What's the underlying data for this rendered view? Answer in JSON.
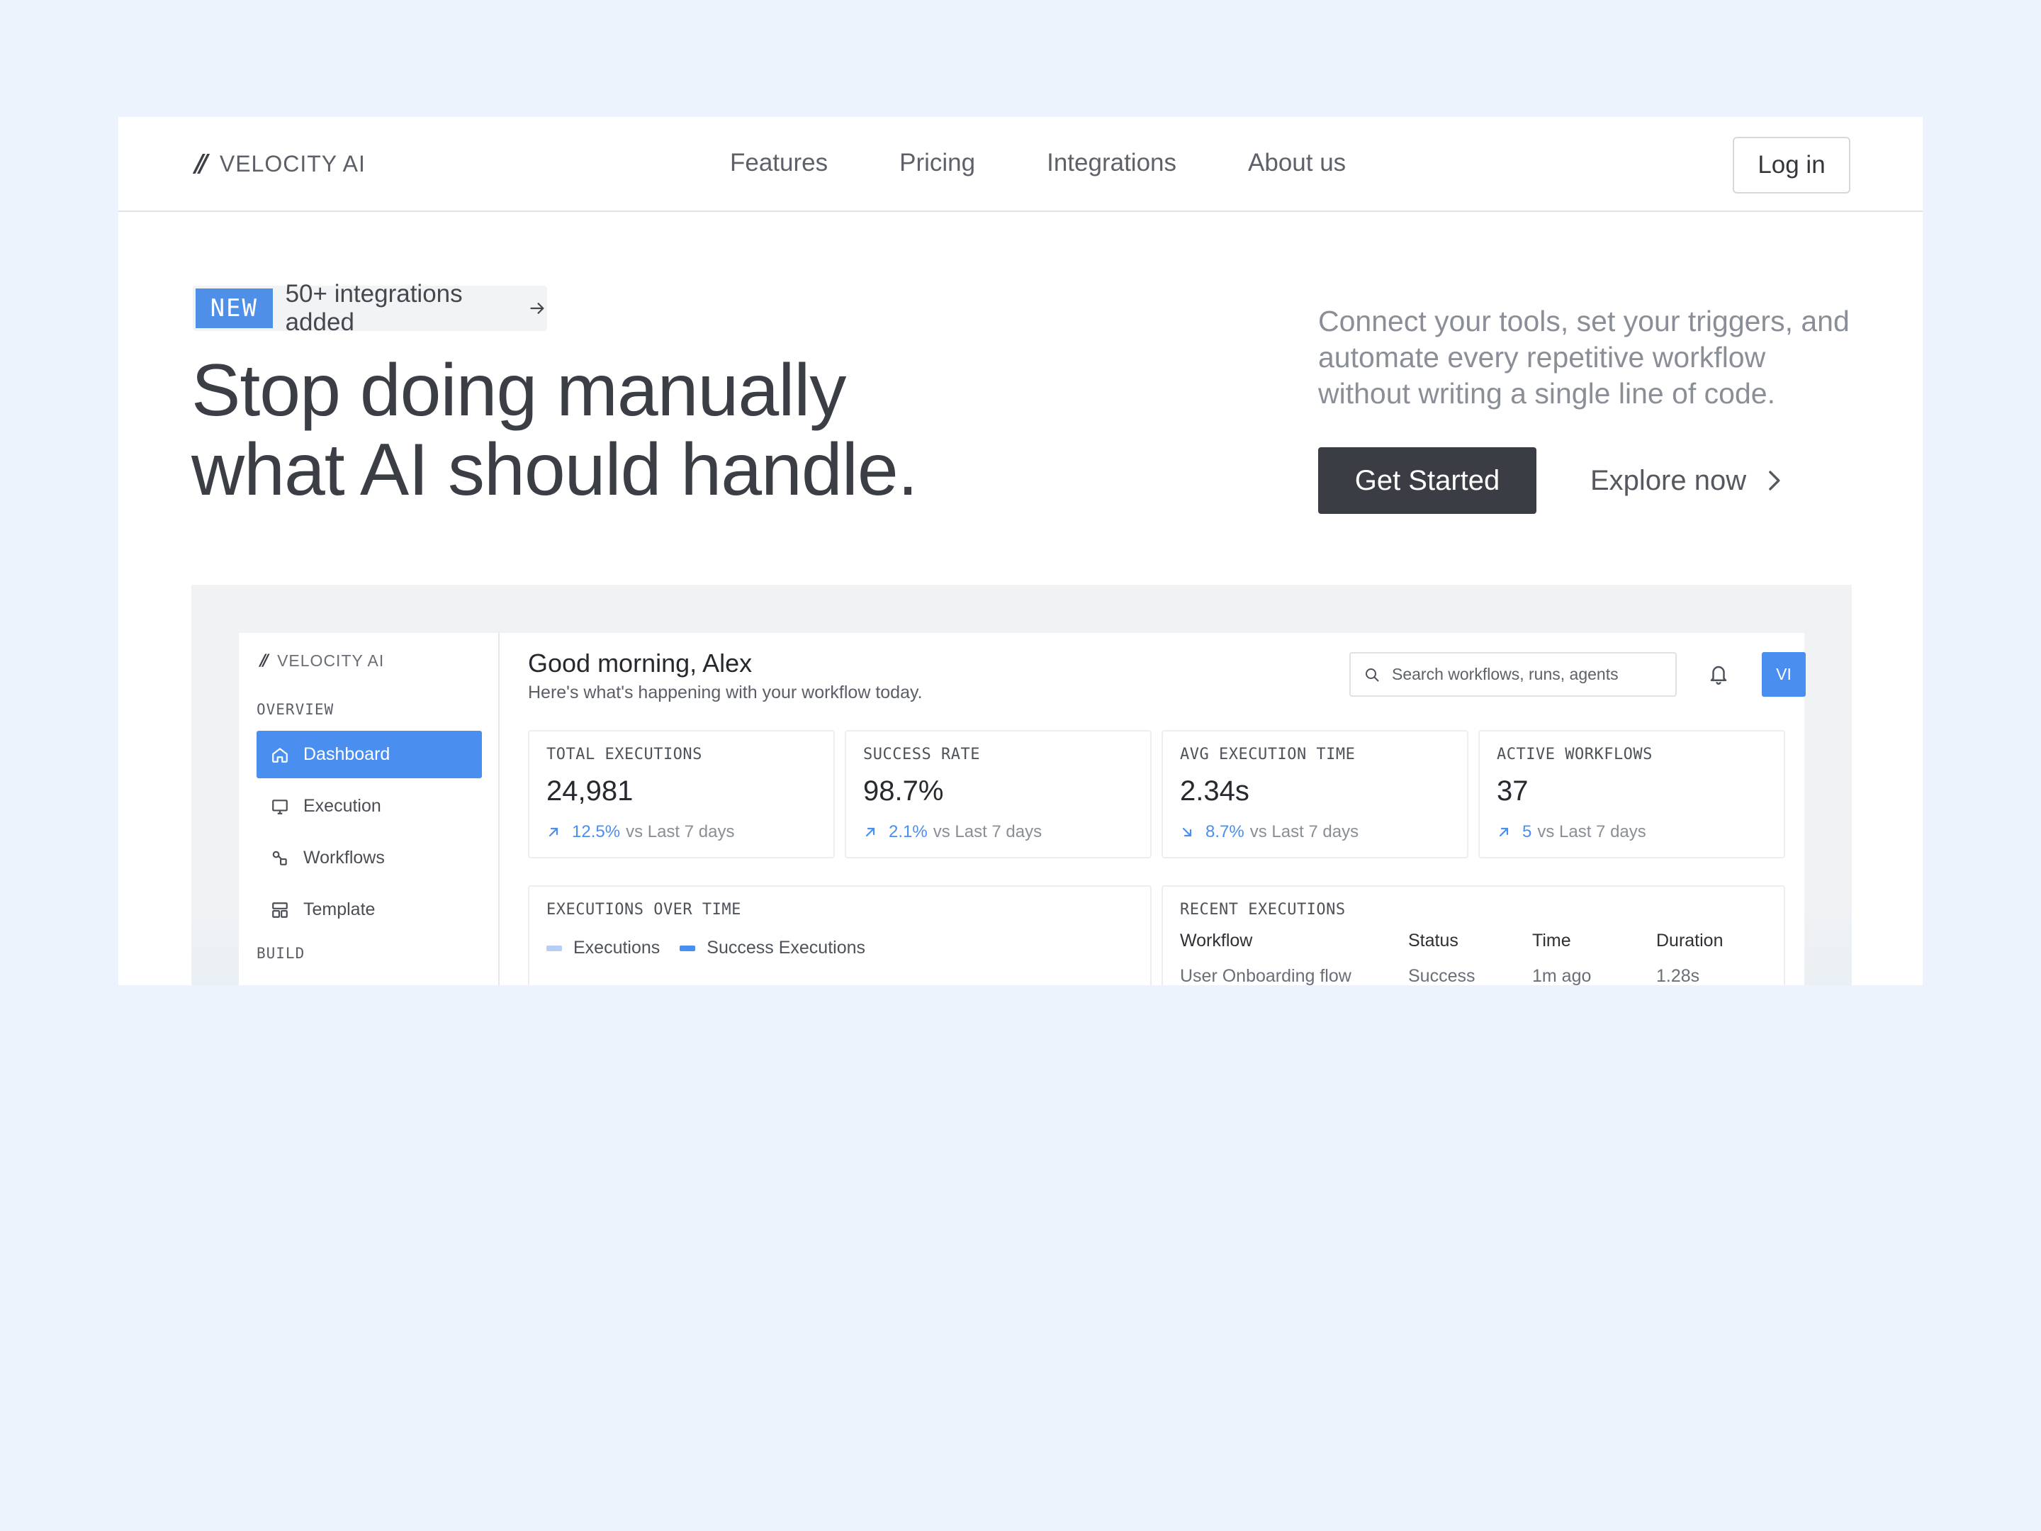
{
  "nav": {
    "brand_mark": "//",
    "brand_name": "VELOCITY AI",
    "links": [
      "Features",
      "Pricing",
      "Integrations",
      "About us"
    ],
    "login_label": "Log in"
  },
  "hero": {
    "badge_tag": "NEW",
    "badge_text": "50+ integrations added",
    "title_line1": "Stop doing manually",
    "title_line2": "what AI should handle.",
    "description": "Connect your tools, set your triggers, and automate every repetitive workflow without writing a single line of code.",
    "cta_primary": "Get Started",
    "cta_secondary": "Explore now"
  },
  "app": {
    "brand_mark": "//",
    "brand_name": "VELOCITY AI",
    "sidebar": {
      "section_overview": "OVERVIEW",
      "section_build": "BUILD",
      "items": [
        {
          "label": "Dashboard",
          "icon": "home-icon",
          "active": true
        },
        {
          "label": "Execution",
          "icon": "monitor-icon",
          "active": false
        },
        {
          "label": "Workflows",
          "icon": "workflow-icon",
          "active": false
        },
        {
          "label": "Template",
          "icon": "template-icon",
          "active": false
        }
      ]
    },
    "greeting": "Good morning, Alex",
    "greeting_sub": "Here's what's happening with your workflow today.",
    "search_placeholder": "Search workflows, runs, agents",
    "avatar_initials": "VI",
    "stats": [
      {
        "label": "TOTAL EXECUTIONS",
        "value": "24,981",
        "pct": "12.5%",
        "trend": "up",
        "suffix": "vs Last 7 days"
      },
      {
        "label": "SUCCESS RATE",
        "value": "98.7%",
        "pct": "2.1%",
        "trend": "up",
        "suffix": "vs Last 7 days"
      },
      {
        "label": "AVG EXECUTION TIME",
        "value": "2.34s",
        "pct": "8.7%",
        "trend": "down",
        "suffix": "vs Last 7 days"
      },
      {
        "label": "ACTIVE WORKFLOWS",
        "value": "37",
        "pct": "5",
        "trend": "up",
        "suffix": "vs Last 7 days"
      }
    ],
    "executions_chart": {
      "title": "EXECUTIONS OVER TIME",
      "legend": [
        {
          "label": "Executions",
          "color": "#b7cdf3"
        },
        {
          "label": "Success Executions",
          "color": "#4a8ef0"
        }
      ]
    },
    "recent": {
      "title": "RECENT EXECUTIONS",
      "columns": [
        "Workflow",
        "Status",
        "Time",
        "Duration"
      ],
      "rows": [
        [
          "User Onboarding flow",
          "Success",
          "1m ago",
          "1.28s"
        ]
      ]
    }
  },
  "colors": {
    "page_bg": "#edf3fd",
    "accent": "#4a8ef0",
    "primary_button": "#3a3d43"
  }
}
